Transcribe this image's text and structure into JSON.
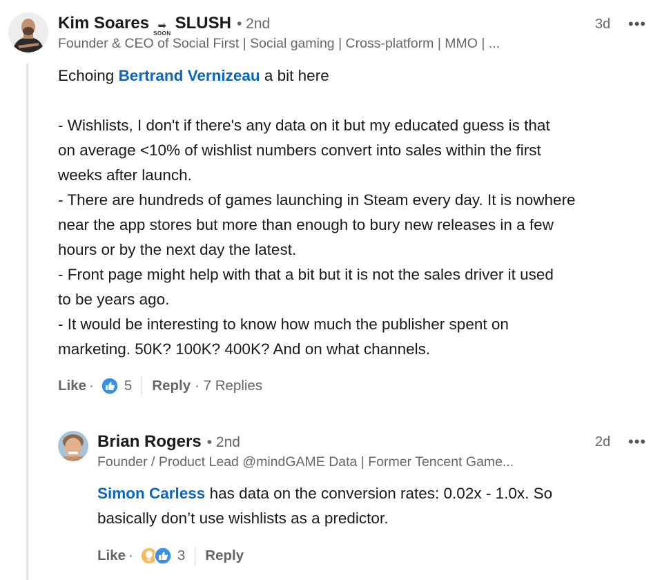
{
  "comment": {
    "author": "Kim Soares",
    "badge_text": "SOON",
    "badge_suffix": "SLUSH",
    "degree": "• 2nd",
    "headline": "Founder & CEO of Social First | Social gaming | Cross-platform | MMO | ...",
    "time": "3d",
    "more_label": "•••",
    "text_intro_before": "Echoing ",
    "mention": "Bertrand Vernizeau",
    "text_intro_after": " a bit here",
    "lines": [
      "- Wishlists, I don't if there's any data on it but my educated guess is that",
      "on average <10% of wishlist numbers convert into sales within the first",
      "weeks after launch.",
      "- There are hundreds of games launching in Steam every day. It is nowhere",
      "near the app stores but more than enough to bury new releases in a few",
      "hours or by the next day the latest.",
      "- Front page might help with that a bit but it is not the sales driver it used",
      "to be years ago.",
      "- It would be interesting to know how much the publisher spent on",
      "marketing. 50K? 100K? 400K? And on what channels."
    ],
    "like_label": "Like",
    "dot": "·",
    "reaction_count": "5",
    "reply_label": "Reply",
    "replies_count": "· 7 Replies",
    "colors": {
      "like_blue": "#378fe9",
      "mention": "#0a66c2"
    },
    "reaction_icons": [
      "like-icon"
    ]
  },
  "reply": {
    "author": "Brian Rogers",
    "degree": "• 2nd",
    "headline": "Founder / Product Lead @mindGAME Data | Former Tencent Game...",
    "time": "2d",
    "more_label": "•••",
    "mention": "Simon Carless",
    "line1_after": " has data on the conversion rates: 0.02x - 1.0x. So",
    "line2": "basically don’t use wishlists as a predictor.",
    "like_label": "Like",
    "dot": "·",
    "reaction_count": "3",
    "reply_label": "Reply",
    "reaction_icons": [
      "insightful-icon",
      "like-icon"
    ]
  }
}
